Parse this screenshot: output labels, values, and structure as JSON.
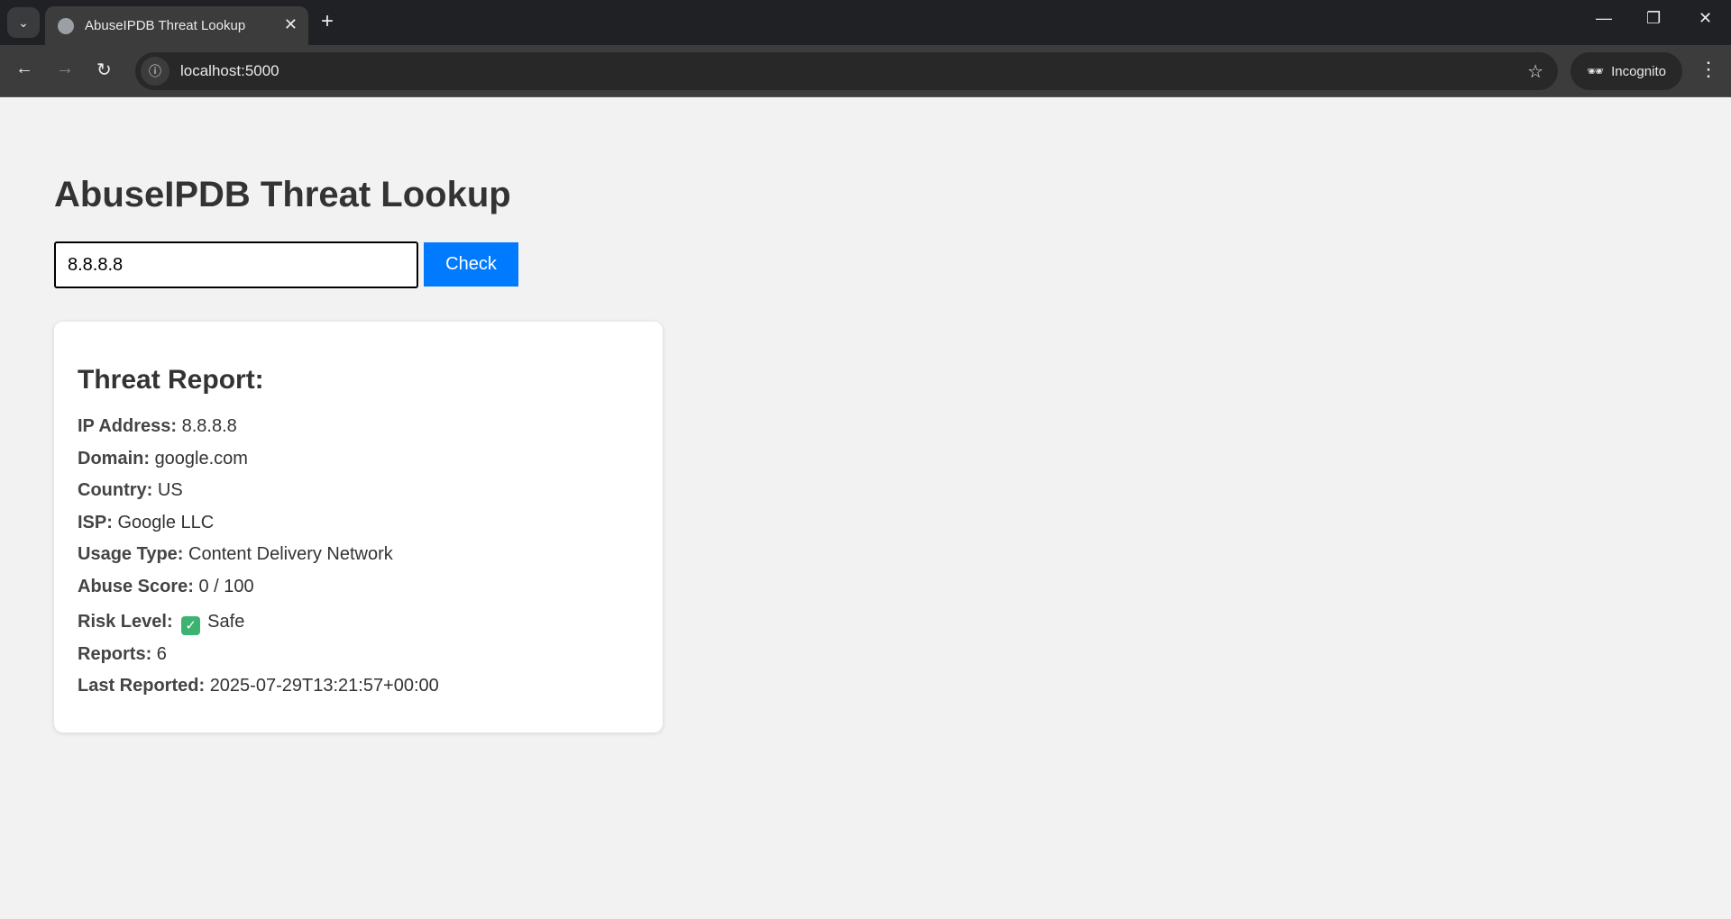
{
  "browser": {
    "tab_title": "AbuseIPDB Threat Lookup",
    "url": "localhost:5000",
    "incognito_label": "Incognito"
  },
  "page": {
    "title": "AbuseIPDB Threat Lookup",
    "ip_input_value": "8.8.8.8",
    "check_label": "Check"
  },
  "report": {
    "heading": "Threat Report:",
    "rows": [
      {
        "label": "IP Address:",
        "value": "8.8.8.8"
      },
      {
        "label": "Domain:",
        "value": "google.com"
      },
      {
        "label": "Country:",
        "value": "US"
      },
      {
        "label": "ISP:",
        "value": "Google LLC"
      },
      {
        "label": "Usage Type:",
        "value": "Content Delivery Network"
      },
      {
        "label": "Abuse Score:",
        "value": "0 / 100"
      },
      {
        "label": "Risk Level:",
        "value": "Safe",
        "icon": "check-mark-button-icon"
      },
      {
        "label": "Reports:",
        "value": "6"
      },
      {
        "label": "Last Reported:",
        "value": "2025-07-29T13:21:57+00:00"
      }
    ]
  },
  "colors": {
    "accent": "#007bff",
    "safe": "#3cb371"
  }
}
